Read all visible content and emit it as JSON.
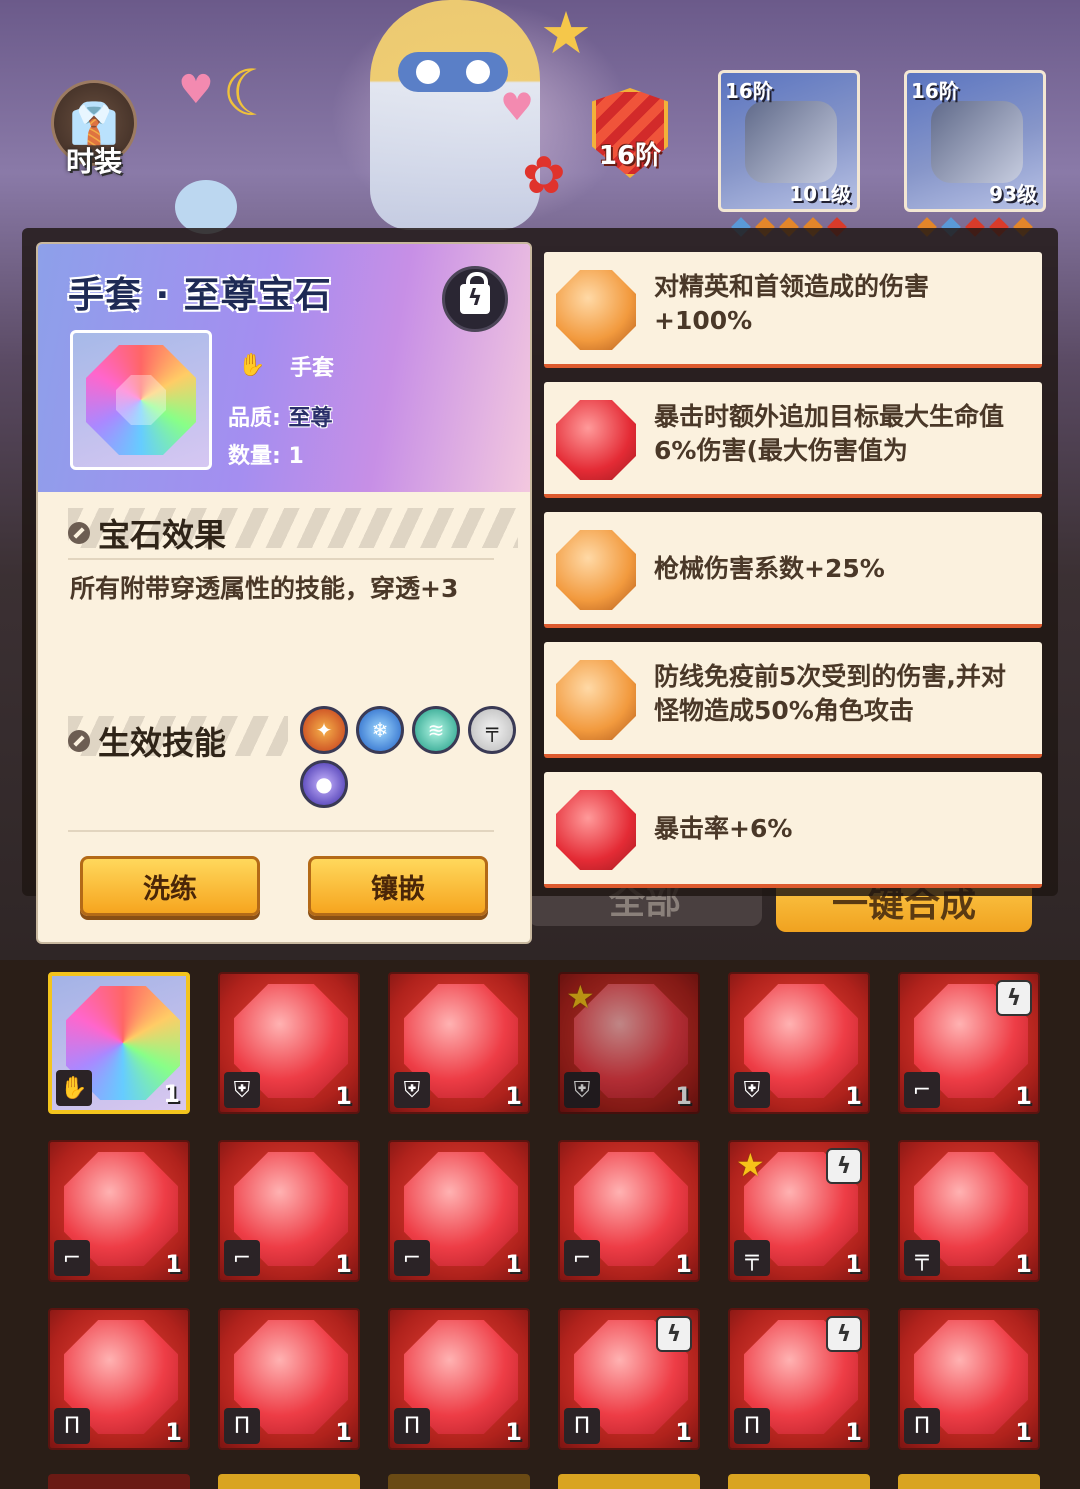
{
  "header": {
    "fashion_label": "时装",
    "fashion_icon": "jacket-icon",
    "rank_badge": "16阶",
    "equip": [
      {
        "tier": "16阶",
        "level": "101级",
        "icon": "helmet-icon"
      },
      {
        "tier": "16阶",
        "level": "93级",
        "icon": "glove-armor-icon"
      }
    ]
  },
  "popup": {
    "title": "手套 · 至尊宝石",
    "slot_type": "手套",
    "quality_label": "品质:",
    "quality_value": "至尊",
    "count_label": "数量:",
    "count_value": "1",
    "effect_heading": "宝石效果",
    "effect_text": "所有附带穿透属性的技能，穿透+3",
    "skills_heading": "生效技能",
    "skills": [
      "fire-skill-icon",
      "ice-skill-icon",
      "wind-skill-icon",
      "rifle-skill-icon",
      "orb-skill-icon"
    ],
    "reforge_button": "洗练",
    "inlay_button": "镶嵌"
  },
  "attributes": [
    {
      "gem": "orange",
      "text": "对精英和首领造成的伤害+100%"
    },
    {
      "gem": "red",
      "text": "暴击时额外追加目标最大生命值6%伤害(最大伤害值为"
    },
    {
      "gem": "orange",
      "text": "枪械伤害系数+25%"
    },
    {
      "gem": "orange",
      "text": "防线免疫前5次受到的伤害,并对怪物造成50%角色攻击"
    },
    {
      "gem": "red",
      "text": "暴击率+6%"
    }
  ],
  "background_buttons": {
    "all": "全部",
    "merge": "一键合成"
  },
  "grid": {
    "rows": [
      [
        {
          "type": "rainbow",
          "slot": "glove",
          "qty": "1",
          "selected": true
        },
        {
          "type": "red",
          "slot": "armor",
          "qty": "1"
        },
        {
          "type": "red",
          "slot": "armor",
          "qty": "1"
        },
        {
          "type": "red",
          "slot": "armor",
          "qty": "1",
          "star": true,
          "dim": true
        },
        {
          "type": "red",
          "slot": "armor",
          "qty": "1"
        },
        {
          "type": "red",
          "slot": "boot",
          "qty": "1",
          "locked": true
        }
      ],
      [
        {
          "type": "red",
          "slot": "boot",
          "qty": "1"
        },
        {
          "type": "red",
          "slot": "boot",
          "qty": "1"
        },
        {
          "type": "red",
          "slot": "boot",
          "qty": "1"
        },
        {
          "type": "red",
          "slot": "boot",
          "qty": "1"
        },
        {
          "type": "red",
          "slot": "gun",
          "qty": "1",
          "star": true,
          "locked": true
        },
        {
          "type": "red",
          "slot": "gun",
          "qty": "1"
        }
      ],
      [
        {
          "type": "red",
          "slot": "pants",
          "qty": "1"
        },
        {
          "type": "red",
          "slot": "pants",
          "qty": "1"
        },
        {
          "type": "red",
          "slot": "pants",
          "qty": "1"
        },
        {
          "type": "red",
          "slot": "pants",
          "qty": "1",
          "locked": true
        },
        {
          "type": "red",
          "slot": "pants",
          "qty": "1",
          "locked": true
        },
        {
          "type": "red",
          "slot": "pants",
          "qty": "1"
        }
      ]
    ]
  },
  "colors": {
    "accent_yellow": "#f6a51f",
    "gem_red": "#e42b35",
    "gem_orange": "#f29a3e",
    "panel_bg": "#fbf1de",
    "page_bg": "#2a1e17"
  }
}
